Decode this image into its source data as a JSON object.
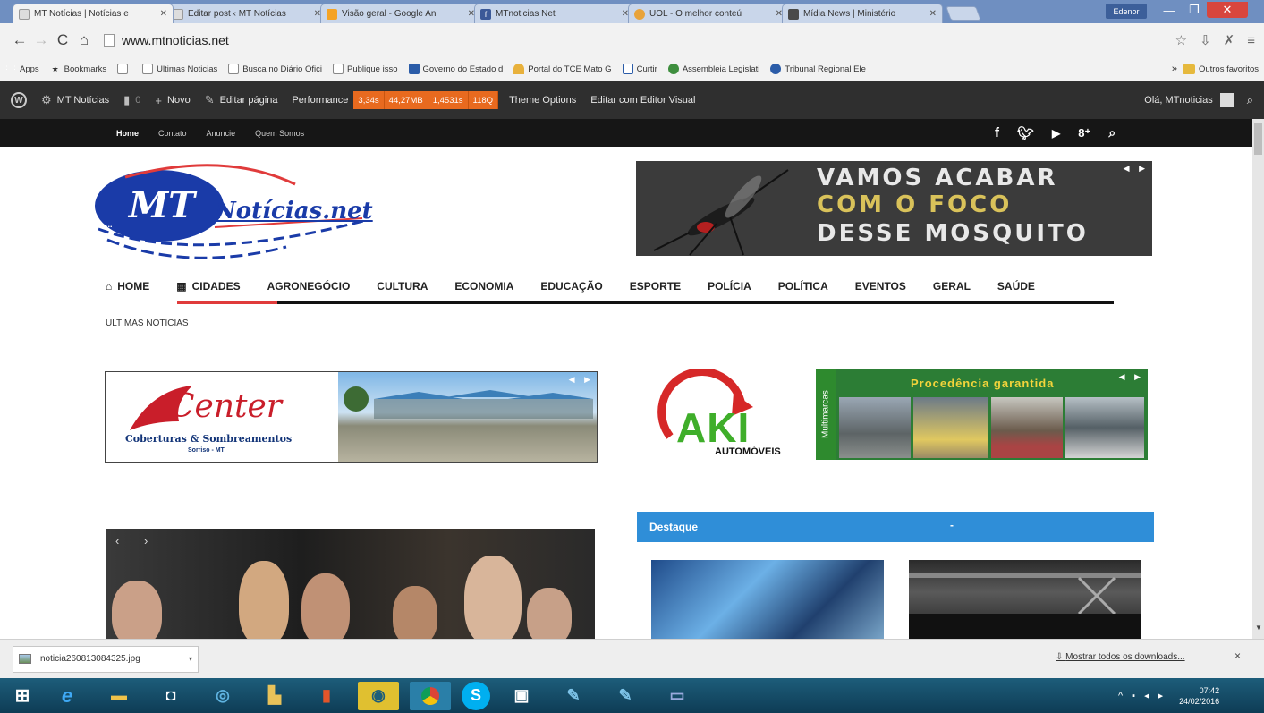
{
  "browser": {
    "tabs": [
      {
        "label": "MT Notícias | Notícias e",
        "active": true,
        "favicon_color": "#dddddd"
      },
      {
        "label": "Editar post ‹ MT Notícias",
        "active": false,
        "favicon_color": "#dddddd"
      },
      {
        "label": "Visão geral - Google An",
        "active": false,
        "favicon_color": "#f4a326"
      },
      {
        "label": "MTnoticias Net",
        "active": false,
        "favicon_color": "#3b5998"
      },
      {
        "label": "UOL - O melhor conteú",
        "active": false,
        "favicon_color": "#e8a33a"
      },
      {
        "label": "Mídia News | Ministério",
        "active": false,
        "favicon_color": "#4a4a4a"
      }
    ],
    "profile_label": "Edenor",
    "url": "www.mtnoticias.net",
    "bookmarks": [
      {
        "label": "Apps",
        "icon": "apps-grid-icon"
      },
      {
        "label": "Bookmarks",
        "icon": "star-icon"
      },
      {
        "label": "",
        "icon": "page-icon"
      },
      {
        "label": "Ultimas Noticias",
        "icon": "page-icon"
      },
      {
        "label": "Busca no Diário Ofici",
        "icon": "page-icon"
      },
      {
        "label": "Publique isso",
        "icon": "page-icon"
      },
      {
        "label": "Governo do Estado d",
        "icon": "governo-icon"
      },
      {
        "label": "Portal do TCE Mato G",
        "icon": "tce-icon"
      },
      {
        "label": "Curtir",
        "icon": "curtir-icon"
      },
      {
        "label": "Assembleia Legislati",
        "icon": "assembleia-icon"
      },
      {
        "label": "Tribunal Regional Ele",
        "icon": "tribunal-icon"
      }
    ],
    "bookmarks_more": "»",
    "other_bookmarks": "Outros favoritos"
  },
  "wp_admin": {
    "site_name": "MT Notícias",
    "comments_count": "0",
    "new_label": "Novo",
    "edit_label": "Editar página",
    "performance_label": "Performance",
    "perf_stats": [
      "3,34s",
      "44,27MB",
      "1,4531s",
      "118Q"
    ],
    "theme_options": "Theme Options",
    "visual_editor": "Editar com Editor Visual",
    "greeting": "Olá, MTnoticias"
  },
  "site": {
    "top_links": [
      "Home",
      "Contato",
      "Anuncie",
      "Quem Somos"
    ],
    "logo_mt": "MT",
    "logo_text": "Notícias.net",
    "logo_prefix": "...",
    "banner_lines": [
      "VAMOS ACABAR",
      "COM O FOCO",
      "DESSE MOSQUITO"
    ],
    "menu": [
      {
        "label": "HOME",
        "icon": "home-icon"
      },
      {
        "label": "CIDADES",
        "icon": "city-icon"
      },
      {
        "label": "AGRONEGÓCIO"
      },
      {
        "label": "CULTURA"
      },
      {
        "label": "ECONOMIA"
      },
      {
        "label": "EDUCAÇÃO"
      },
      {
        "label": "ESPORTE"
      },
      {
        "label": "POLÍCIA"
      },
      {
        "label": "POLÍTICA"
      },
      {
        "label": "EVENTOS"
      },
      {
        "label": "GERAL"
      },
      {
        "label": "SAÚDE"
      }
    ],
    "ultimas": "ULTIMAS NOTICIAS",
    "ad_center": {
      "name": "Center",
      "subtitle": "Coberturas & Sombreamentos",
      "city": "Sorriso - MT"
    },
    "ad_aki": {
      "brand": "AKI",
      "sub": "AUTOMÓVEIS",
      "side": "Multimarcas",
      "tagline": "Procedência garantida"
    },
    "destaque_title": "Destaque",
    "destaque_dash": "-"
  },
  "download": {
    "filename": "noticia260813084325.jpg",
    "show_all": "Mostrar todos os downloads...",
    "close": "×"
  },
  "taskbar": {
    "time": "07:42",
    "date": "24/02/2016"
  },
  "colors": {
    "accent_orange": "#e86a1f",
    "destaque_blue": "#2f8ed8",
    "menu_red": "#e03b3b",
    "logo_blue": "#1a3ba8"
  }
}
